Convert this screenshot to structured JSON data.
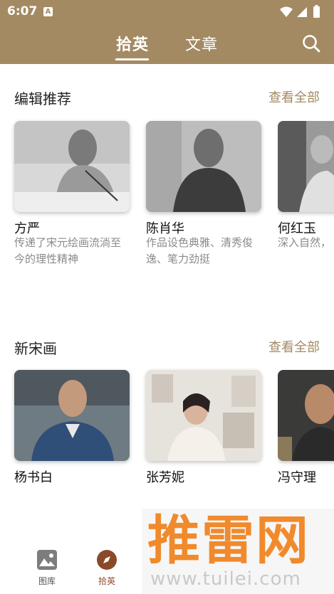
{
  "status_bar": {
    "time": "6:07",
    "notification_letter": "A"
  },
  "header": {
    "tabs": [
      {
        "label": "拾英",
        "active": true
      },
      {
        "label": "文章",
        "active": false
      }
    ],
    "search_icon": "search-icon",
    "background": "#a48a63"
  },
  "sections": [
    {
      "title": "编辑推荐",
      "see_all": "查看全部",
      "cards": [
        {
          "name": "方严",
          "desc": "传递了宋元绘画流淌至今的理性精神"
        },
        {
          "name": "陈肖华",
          "desc": "作品设色典雅、清秀俊逸、笔力劲挺"
        },
        {
          "name": "何红玉",
          "desc": "深入自然，"
        }
      ]
    },
    {
      "title": "新宋画",
      "see_all": "查看全部",
      "cards": [
        {
          "name": "杨书白"
        },
        {
          "name": "张芳妮"
        },
        {
          "name": "冯守理"
        }
      ]
    }
  ],
  "bottom_nav": [
    {
      "label": "图库",
      "icon": "gallery-icon",
      "active": false
    },
    {
      "label": "拾英",
      "icon": "compass-icon",
      "active": true
    }
  ],
  "watermark": {
    "text": "推雷网",
    "url": "www.tuilei.com"
  },
  "colors": {
    "accent": "#a48a63",
    "active_nav": "#8a4a2a",
    "watermark": "#f08a2c"
  }
}
